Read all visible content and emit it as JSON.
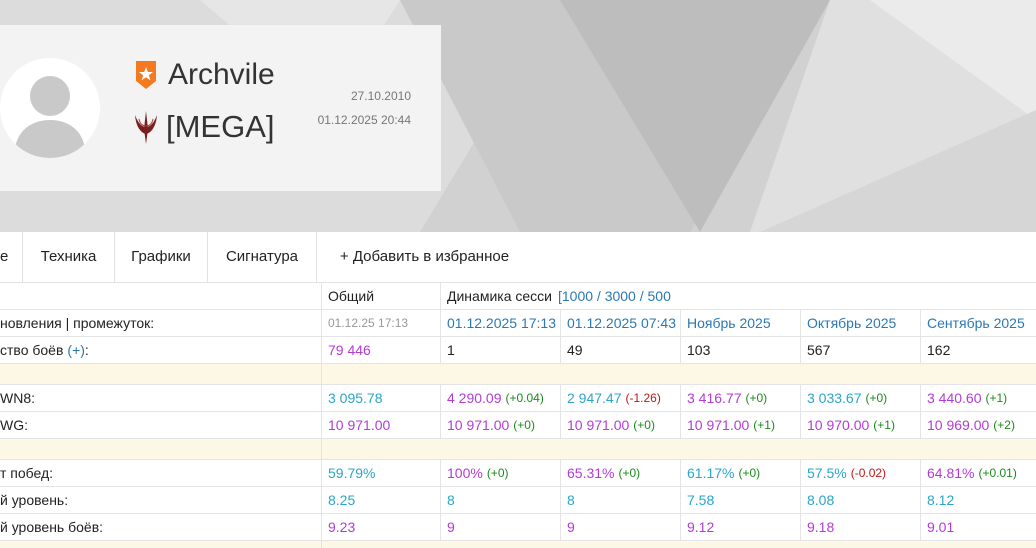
{
  "profile": {
    "player_name": "Archvile",
    "clan_tag": "[MEGA]",
    "registered_date": "27.10.2010",
    "last_battle_date": "01.12.2025 20:44",
    "rank_icon": "orange-shield-star-icon",
    "clan_icon": "quake-clan-emblem-icon",
    "colors": {
      "rank_badge": "#f37a21",
      "clan_emblem": "#7a1f1f"
    }
  },
  "tabs": [
    {
      "label": "е"
    },
    {
      "label": "Техника"
    },
    {
      "label": "Графики"
    },
    {
      "label": "Сигнатура"
    },
    {
      "label": "+ Добавить в избранное"
    }
  ],
  "table": {
    "headers": {
      "overall": "Общий",
      "dynamics": "Динамика сесси",
      "dynamics_link": "[1000 / 3000 / 500"
    },
    "row_update": {
      "label": "новления | промежуток:",
      "values": [
        "01.12.25 17:13",
        "01.12.2025 17:13",
        "01.12.2025 07:43",
        "Ноябрь 2025",
        "Октябрь 2025",
        "Сентябрь 2025"
      ]
    },
    "row_battles": {
      "label": "ство боёв",
      "link": "(+)",
      "suffix": ":",
      "values": [
        "79 446",
        "1",
        "49",
        "103",
        "567",
        "162"
      ]
    },
    "row_wn8": {
      "label": "WN8:",
      "values": [
        {
          "v": "3 095.78",
          "d": ""
        },
        {
          "v": "4 290.09",
          "d": "(+0.04)"
        },
        {
          "v": "2 947.47",
          "d": "(-1.26)"
        },
        {
          "v": "3 416.77",
          "d": "(+0)"
        },
        {
          "v": "3 033.67",
          "d": "(+0)"
        },
        {
          "v": "3 440.60",
          "d": "(+1)"
        }
      ]
    },
    "row_wg": {
      "label": "WG:",
      "values": [
        {
          "v": "10 971.00",
          "d": ""
        },
        {
          "v": "10 971.00",
          "d": "(+0)"
        },
        {
          "v": "10 971.00",
          "d": "(+0)"
        },
        {
          "v": "10 971.00",
          "d": "(+1)"
        },
        {
          "v": "10 970.00",
          "d": "(+1)"
        },
        {
          "v": "10 969.00",
          "d": "(+2)"
        }
      ]
    },
    "row_winrate": {
      "label": "т побед:",
      "values": [
        {
          "v": "59.79%",
          "d": ""
        },
        {
          "v": "100%",
          "d": "(+0)"
        },
        {
          "v": "65.31%",
          "d": "(+0)"
        },
        {
          "v": "61.17%",
          "d": "(+0)"
        },
        {
          "v": "57.5%",
          "d": "(-0.02)"
        },
        {
          "v": "64.81%",
          "d": "(+0.01)"
        }
      ]
    },
    "row_avg_level": {
      "label": "й уровень:",
      "values": [
        "8.25",
        "8",
        "8",
        "7.58",
        "8.08",
        "8.12"
      ]
    },
    "row_avg_battle_level": {
      "label": "й уровень боёв:",
      "values": [
        "9.23",
        "9",
        "9",
        "9.12",
        "9.18",
        "9.01"
      ]
    }
  }
}
